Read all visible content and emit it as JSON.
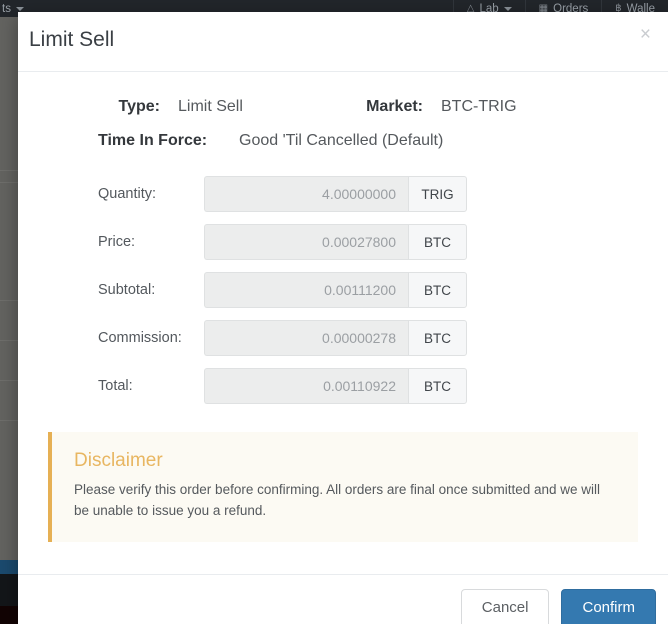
{
  "navbar": {
    "items": [
      {
        "label": "ts",
        "icon": "chevron-down-icon",
        "leading_icon": ""
      },
      {
        "label": "Lab",
        "icon": "chevron-down-icon",
        "leading_icon": "flask-icon"
      },
      {
        "label": "Orders",
        "icon": "",
        "leading_icon": "grid-icon"
      },
      {
        "label": "Walle",
        "icon": "",
        "leading_icon": "bitcoin-icon"
      }
    ]
  },
  "modal": {
    "title": "Limit Sell",
    "close_label": "×",
    "summary": {
      "type_label": "Type:",
      "type_value": "Limit Sell",
      "market_label": "Market:",
      "market_value": "BTC-TRIG",
      "tif_label": "Time In Force:",
      "tif_value": "Good 'Til Cancelled (Default)"
    },
    "fields": [
      {
        "label": "Quantity:",
        "value": "4.00000000",
        "unit": "TRIG"
      },
      {
        "label": "Price:",
        "value": "0.00027800",
        "unit": "BTC"
      },
      {
        "label": "Subtotal:",
        "value": "0.00111200",
        "unit": "BTC"
      },
      {
        "label": "Commission:",
        "value": "0.00000278",
        "unit": "BTC"
      },
      {
        "label": "Total:",
        "value": "0.00110922",
        "unit": "BTC"
      }
    ],
    "disclaimer": {
      "title": "Disclaimer",
      "text": "Please verify this order before confirming. All orders are final once submitted and we will be unable to issue you a refund."
    },
    "footer": {
      "cancel_label": "Cancel",
      "confirm_label": "Confirm"
    }
  },
  "colors": {
    "accent_blue": "#3479b0",
    "disclaimer_border": "#e6b054",
    "disclaimer_title": "#e8b661",
    "navbar_bg": "#22262b"
  }
}
